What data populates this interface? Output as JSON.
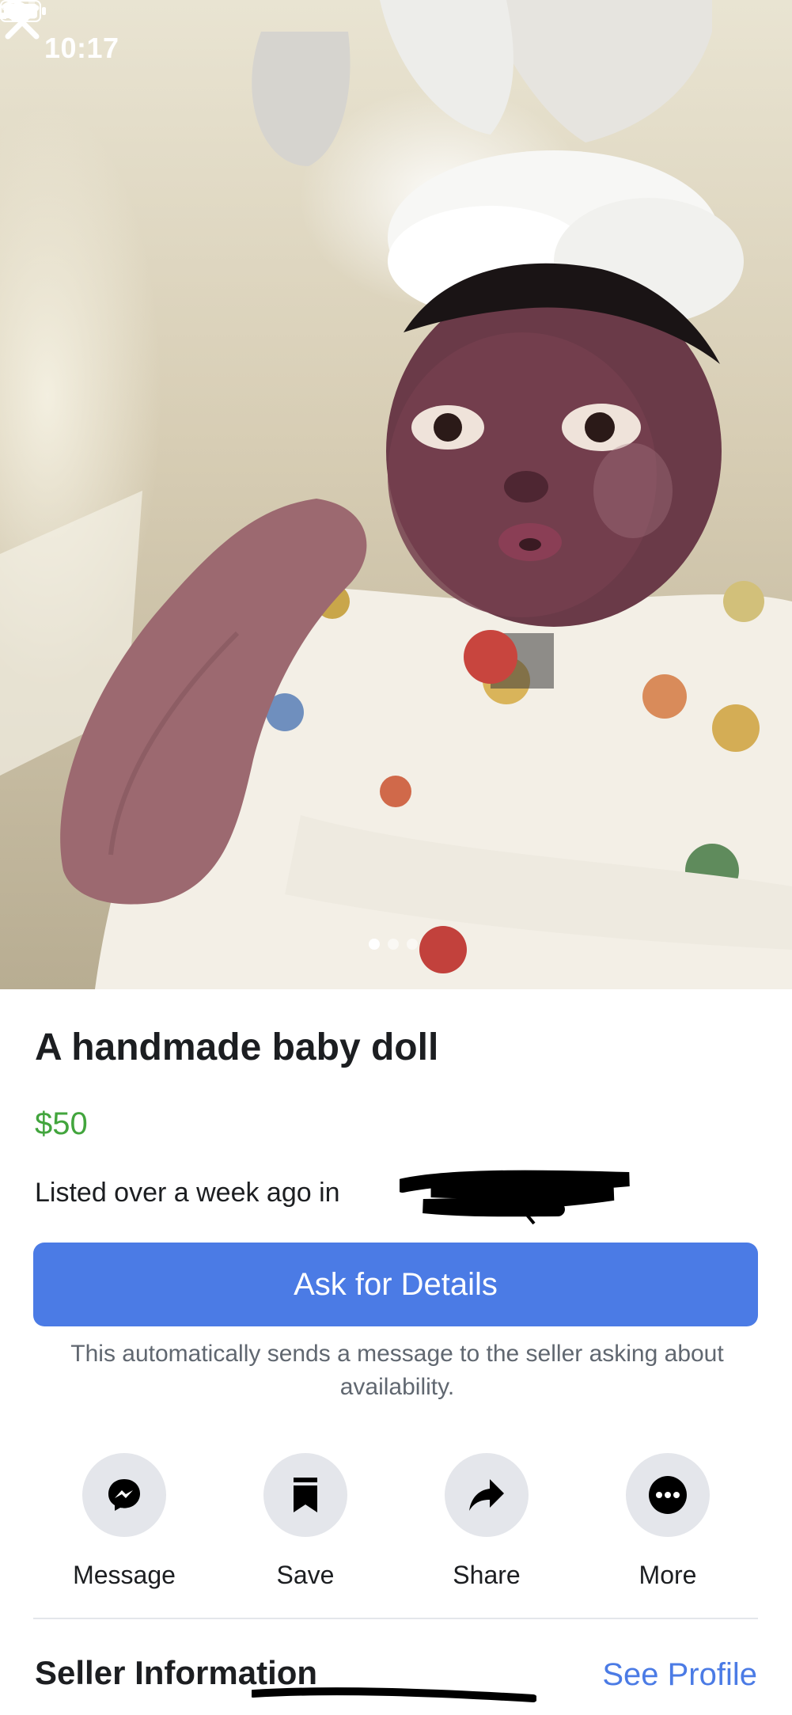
{
  "status_bar": {
    "time": "10:17",
    "location_icon": "location-arrow-icon",
    "signal_icon": "cellular-signal-icon",
    "wifi_icon": "wifi-icon",
    "battery_icon": "battery-icon"
  },
  "photo": {
    "close_icon": "close-icon",
    "image_count": 3,
    "active_index": 0
  },
  "listing": {
    "title": "A handmade baby doll",
    "price": "$50",
    "listed_text": "Listed over a week ago in",
    "ask_button": "Ask for Details",
    "note": "This automatically sends a message to the seller asking about availability."
  },
  "actions": [
    {
      "label": "Message",
      "icon": "messenger-icon"
    },
    {
      "label": "Save",
      "icon": "bookmark-icon"
    },
    {
      "label": "Share",
      "icon": "share-arrow-icon"
    },
    {
      "label": "More",
      "icon": "more-dots-icon"
    }
  ],
  "seller": {
    "heading": "Seller Information",
    "see_profile": "See Profile"
  },
  "colors": {
    "accent": "#4b7be5",
    "price": "#42a53d",
    "text": "#1c1e21",
    "muted": "#606770",
    "icon_bg": "#e4e6eb"
  }
}
